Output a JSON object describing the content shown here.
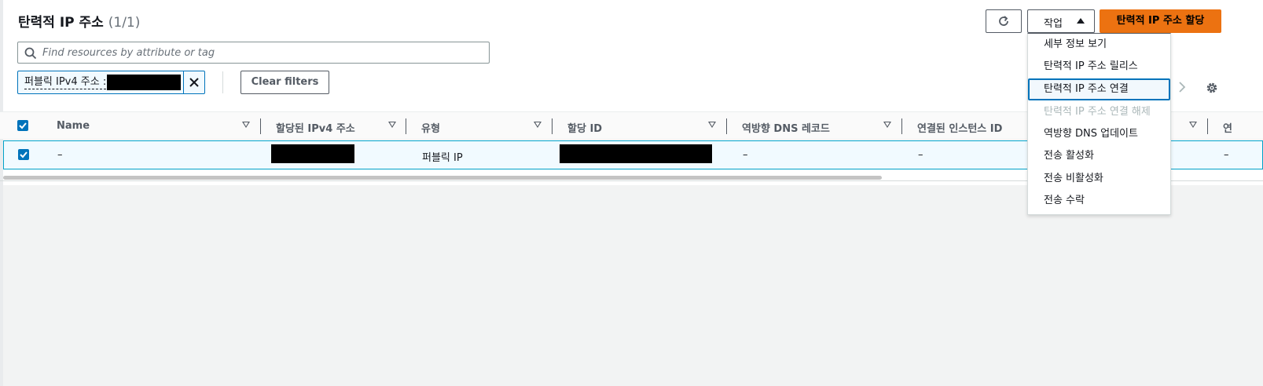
{
  "header": {
    "title": "탄력적 IP 주소",
    "count": "(1/1)"
  },
  "search": {
    "placeholder": "Find resources by attribute or tag"
  },
  "filter_token": {
    "label": "퍼블릭 IPv4 주소 :"
  },
  "buttons": {
    "clear_filters": "Clear filters",
    "actions": "작업",
    "allocate": "탄력적 IP 주소 할당"
  },
  "actions_menu": {
    "items": [
      {
        "label": "세부 정보 보기",
        "disabled": false
      },
      {
        "label": "탄력적 IP 주소 릴리스",
        "disabled": false
      },
      {
        "label": "탄력적 IP 주소 연결",
        "disabled": false,
        "active": true
      },
      {
        "label": "탄력적 IP 주소 연결 해제",
        "disabled": true
      },
      {
        "label": "역방향 DNS 업데이트",
        "disabled": false
      },
      {
        "label": "전송 활성화",
        "disabled": false
      },
      {
        "label": "전송 비활성화",
        "disabled": false
      },
      {
        "label": "전송 수락",
        "disabled": false
      }
    ]
  },
  "table": {
    "columns": [
      "Name",
      "할당된 IPv4 주소",
      "유형",
      "할당 ID",
      "역방향 DNS 레코드",
      "연결된 인스턴스 ID",
      "연"
    ],
    "rows": [
      {
        "name": "–",
        "ipv4": "",
        "type": "퍼블릭 IP",
        "allocation_id": "",
        "reverse_dns": "–",
        "instance_id": "–",
        "last": "–",
        "selected": true
      }
    ]
  },
  "colors": {
    "accent": "#0073bb",
    "primary_button": "#ec7211",
    "selected_row": "#f1faff"
  },
  "icons": {
    "search": "search-icon",
    "close": "close-icon",
    "refresh": "refresh-icon",
    "caret": "caret-up-icon",
    "next": "chevron-right-icon",
    "settings": "gear-icon",
    "sort": "sort-icon"
  }
}
